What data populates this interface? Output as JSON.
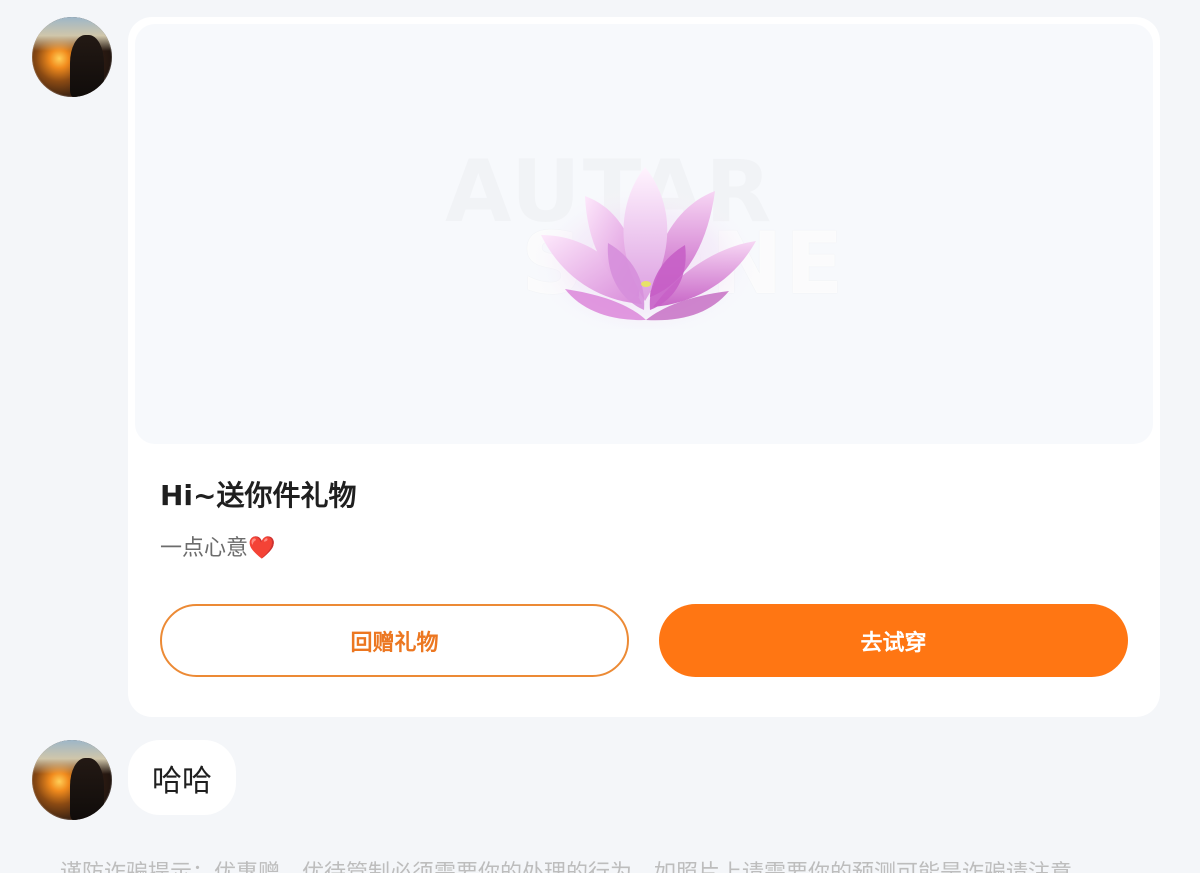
{
  "messages": [
    {
      "type": "gift",
      "title": "Hi~送你件礼物",
      "subtitle": "一点心意",
      "subtitle_emoji": "❤️",
      "watermark": [
        "AUTAR",
        "SCENE"
      ],
      "actions": {
        "return_gift": "回赠礼物",
        "try_on": "去试穿"
      }
    },
    {
      "type": "text",
      "text": "哈哈"
    }
  ],
  "notice": "谨防诈骗提示：优惠赠、优待管制必须需要你的处理的行为，如照片上请需要你的预测可能是诈骗请注意"
}
